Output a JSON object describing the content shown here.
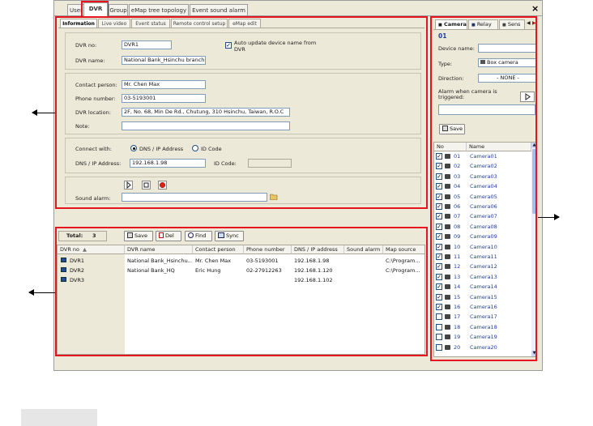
{
  "tabs": [
    "User",
    "DVR",
    "Group",
    "eMap tree topology",
    "Event sound alarm"
  ],
  "close_label": "×",
  "subtabs": [
    "Information",
    "Live video",
    "Event status",
    "Remote control setup",
    "eMap edit"
  ],
  "info": {
    "dvr_no_label": "DVR no:",
    "dvr_no_value": "DVR1",
    "auto_update_label": "Auto update device name from DVR",
    "dvr_name_label": "DVR name:",
    "dvr_name_value": "National Bank_Hsinchu branch",
    "contact_label": "Contact person:",
    "contact_value": "Mr. Chen Max",
    "phone_label": "Phone number:",
    "phone_value": "03-5193001",
    "location_label": "DVR location:",
    "location_value": "2F, No. 68, Min De Rd., Chutung, 310 Hsinchu, Taiwan, R.O.C",
    "note_label": "Note:",
    "note_value": "",
    "connect_label": "Connect with:",
    "radio_dns": "DNS / IP Address",
    "radio_id": "ID Code",
    "dns_label": "DNS / IP Address:",
    "dns_value": "192.168.1.98",
    "idcode_label": "ID Code:",
    "sound_label": "Sound alarm:"
  },
  "list": {
    "total_label": "Total:",
    "total_value": "3",
    "save": "Save",
    "del": "Del",
    "find": "Find",
    "sync": "Sync",
    "headers": [
      "DVR no",
      "DVR name",
      "Contact person",
      "Phone number",
      "DNS / IP address",
      "Sound alarm",
      "Map source"
    ],
    "rows": [
      {
        "no": "DVR1",
        "name": "National Bank_Hsinchu...",
        "contact": "Mr. Chen Max",
        "phone": "03-5193001",
        "ip": "192.168.1.98",
        "map": "C:\\Program..."
      },
      {
        "no": "DVR2",
        "name": "National Bank_HQ",
        "contact": "Eric Hung",
        "phone": "02-27912263",
        "ip": "192.168.1.120",
        "map": "C:\\Program..."
      },
      {
        "no": "DVR3",
        "name": "",
        "contact": "",
        "phone": "",
        "ip": "192.168.1.102",
        "map": ""
      }
    ]
  },
  "right": {
    "tabs": [
      "Camera",
      "Relay",
      "Sens"
    ],
    "cam_no": "01",
    "device_name_label": "Device name:",
    "type_label": "Type:",
    "type_value": "Box camera",
    "direction_label": "Direction:",
    "direction_value": "- NONE -",
    "alarm_label": "Alarm when camera is triggered:",
    "save": "Save",
    "col_no": "No",
    "col_name": "Name",
    "cameras": [
      {
        "no": "01",
        "name": "Camera01",
        "checked": true
      },
      {
        "no": "02",
        "name": "Camera02",
        "checked": true
      },
      {
        "no": "03",
        "name": "Camera03",
        "checked": true
      },
      {
        "no": "04",
        "name": "Camera04",
        "checked": true
      },
      {
        "no": "05",
        "name": "Camera05",
        "checked": true
      },
      {
        "no": "06",
        "name": "Camera06",
        "checked": true
      },
      {
        "no": "07",
        "name": "Camera07",
        "checked": true
      },
      {
        "no": "08",
        "name": "Camera08",
        "checked": true
      },
      {
        "no": "09",
        "name": "Camera09",
        "checked": true
      },
      {
        "no": "10",
        "name": "Camera10",
        "checked": true
      },
      {
        "no": "11",
        "name": "Camera11",
        "checked": true
      },
      {
        "no": "12",
        "name": "Camera12",
        "checked": true
      },
      {
        "no": "13",
        "name": "Camera13",
        "checked": true
      },
      {
        "no": "14",
        "name": "Camera14",
        "checked": true
      },
      {
        "no": "15",
        "name": "Camera15",
        "checked": true
      },
      {
        "no": "16",
        "name": "Camera16",
        "checked": true
      },
      {
        "no": "17",
        "name": "Camera17",
        "checked": false
      },
      {
        "no": "18",
        "name": "Camera18",
        "checked": false
      },
      {
        "no": "19",
        "name": "Camera19",
        "checked": false
      },
      {
        "no": "20",
        "name": "Camera20",
        "checked": false
      }
    ]
  }
}
